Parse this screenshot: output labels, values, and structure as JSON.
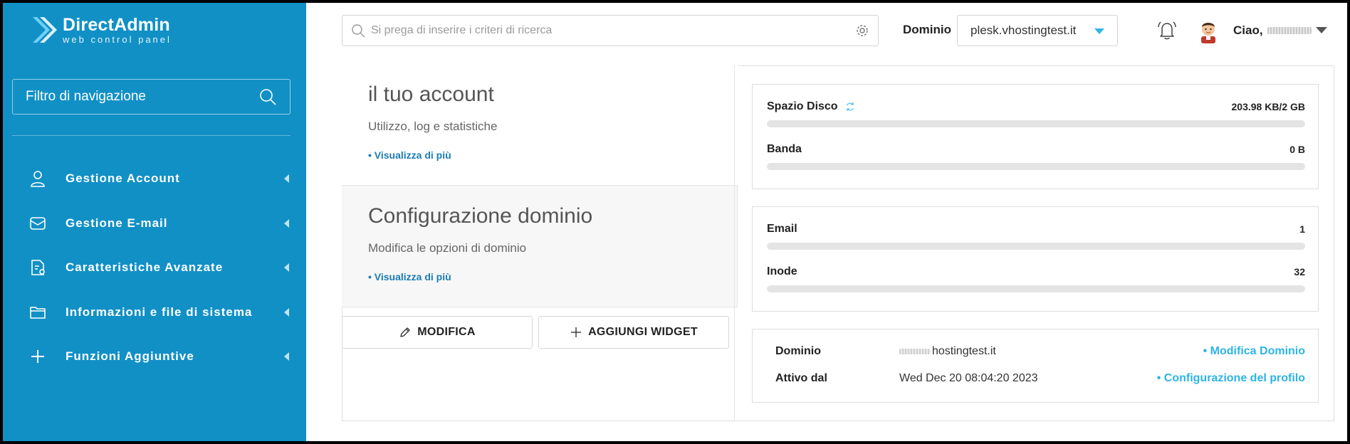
{
  "sidebar": {
    "logo_title": "DirectAdmin",
    "logo_subtitle": "web control panel",
    "filter_placeholder": "Filtro di navigazione",
    "items": [
      {
        "label": "Gestione Account",
        "icon": "user-icon"
      },
      {
        "label": "Gestione E-mail",
        "icon": "mail-icon"
      },
      {
        "label": "Caratteristiche Avanzate",
        "icon": "advanced-file-icon"
      },
      {
        "label": "Informazioni e file di sistema",
        "icon": "folder-icon"
      },
      {
        "label": "Funzioni Aggiuntive",
        "icon": "plus-icon"
      }
    ]
  },
  "header": {
    "search_placeholder": "Si prega di inserire i criteri di ricerca",
    "domain_label": "Dominio",
    "domain_selected": "plesk.vhostingtest.it",
    "greeting": "Ciao,"
  },
  "cards": {
    "account": {
      "title": "il tuo account",
      "subtitle": "Utilizzo, log e statistiche",
      "link": "• Visualizza di più"
    },
    "config": {
      "title": "Configurazione dominio",
      "subtitle": "Modifica le opzioni di dominio",
      "link": "• Visualizza di più"
    }
  },
  "buttons": {
    "modifica": "MODIFICA",
    "widget": "AGGIUNGI WIDGET"
  },
  "stats": {
    "disk": {
      "label": "Spazio Disco",
      "value": "203.98 KB/2 GB",
      "fraction": 0.0
    },
    "bandwidth": {
      "label": "Banda",
      "value": "0 B",
      "fraction": 0.0
    },
    "email": {
      "label": "Email",
      "value": "1",
      "fraction": 0.0
    },
    "inode": {
      "label": "Inode",
      "value": "32",
      "fraction": 0.0
    }
  },
  "info": {
    "domain_key": "Dominio",
    "domain_value": "hostingtest.it",
    "domain_link": "• Modifica Dominio",
    "active_key": "Attivo dal",
    "active_value": "Wed Dec 20 08:04:20 2023",
    "active_link": "• Configurazione del profilo"
  },
  "colors": {
    "sidebar": "#1190c6",
    "accent": "#2cb4e8",
    "link": "#1a7bb3"
  }
}
